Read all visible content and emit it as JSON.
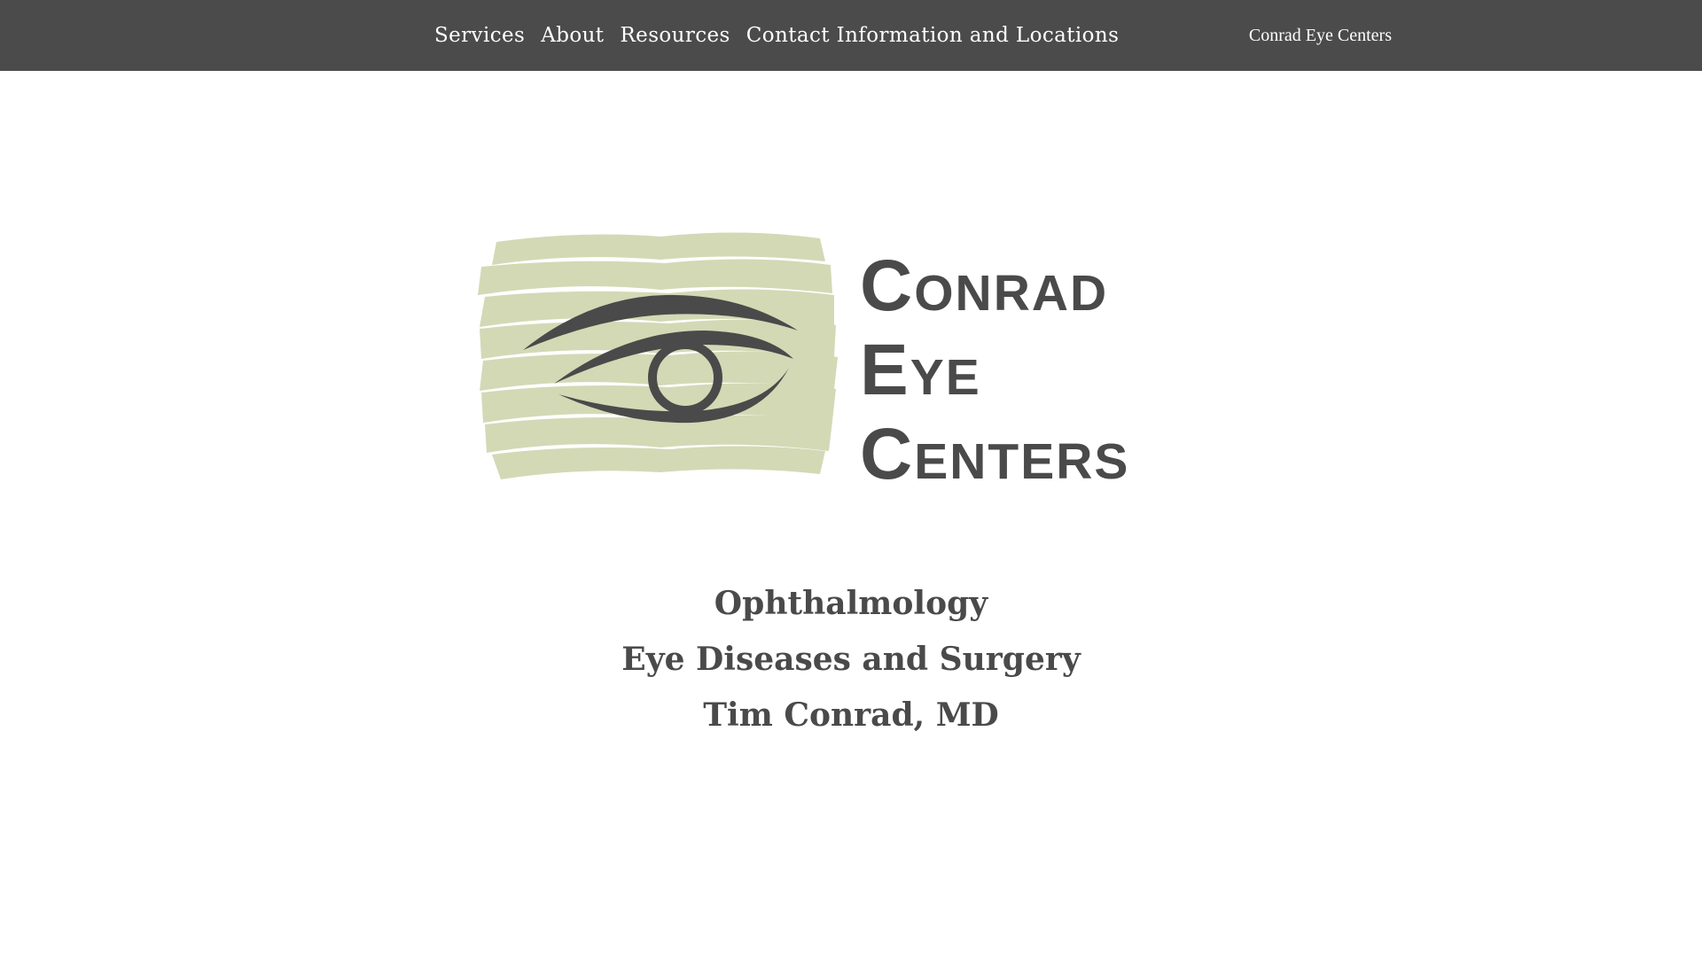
{
  "nav": {
    "items": [
      {
        "label": "Services"
      },
      {
        "label": "About"
      },
      {
        "label": "Resources"
      },
      {
        "label": "Contact Information and Locations"
      }
    ],
    "site_title": "Conrad Eye Centers"
  },
  "logo": {
    "words": [
      "Conrad",
      "Eye",
      "Centers"
    ],
    "icon": "eye-icon",
    "colors": {
      "brush": "#d3d9b5",
      "ink": "#4a4a4a"
    }
  },
  "taglines": [
    "Ophthalmology",
    "Eye Diseases and Surgery",
    "Tim Conrad, MD"
  ],
  "colors": {
    "header_bg": "#4b4b4b",
    "header_text": "#ffffff",
    "body_text": "#4a4a4a",
    "page_bg": "#ffffff"
  }
}
